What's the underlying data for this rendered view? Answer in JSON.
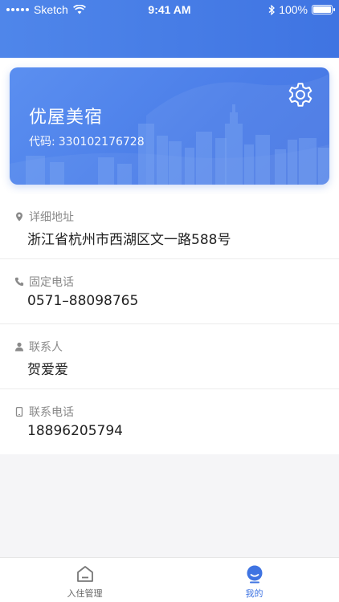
{
  "status_bar": {
    "carrier": "Sketch",
    "time": "9:41 AM",
    "battery": "100%",
    "battery_level": 1.0
  },
  "card": {
    "title": "优屋美宿",
    "code_label": "代码:",
    "code_value": "330102176728",
    "settings_icon": "gear-icon"
  },
  "info": {
    "address": {
      "label": "详细地址",
      "value": "浙江省杭州市西湖区文一路588号",
      "icon": "location-pin-icon"
    },
    "phone": {
      "label": "固定电话",
      "value": "0571–88098765",
      "icon": "phone-icon"
    },
    "contact": {
      "label": "联系人",
      "value": "贺爱爱",
      "icon": "person-icon"
    },
    "mobile": {
      "label": "联系电话",
      "value": "18896205794",
      "icon": "mobile-icon"
    }
  },
  "tabbar": {
    "tabs": [
      {
        "label": "入住管理",
        "icon": "home-icon",
        "active": false
      },
      {
        "label": "我的",
        "icon": "profile-icon",
        "active": true
      }
    ]
  },
  "colors": {
    "accent": "#3f74e2",
    "card_bg": "#4a7de8",
    "label_gray": "#8a8a8a"
  }
}
